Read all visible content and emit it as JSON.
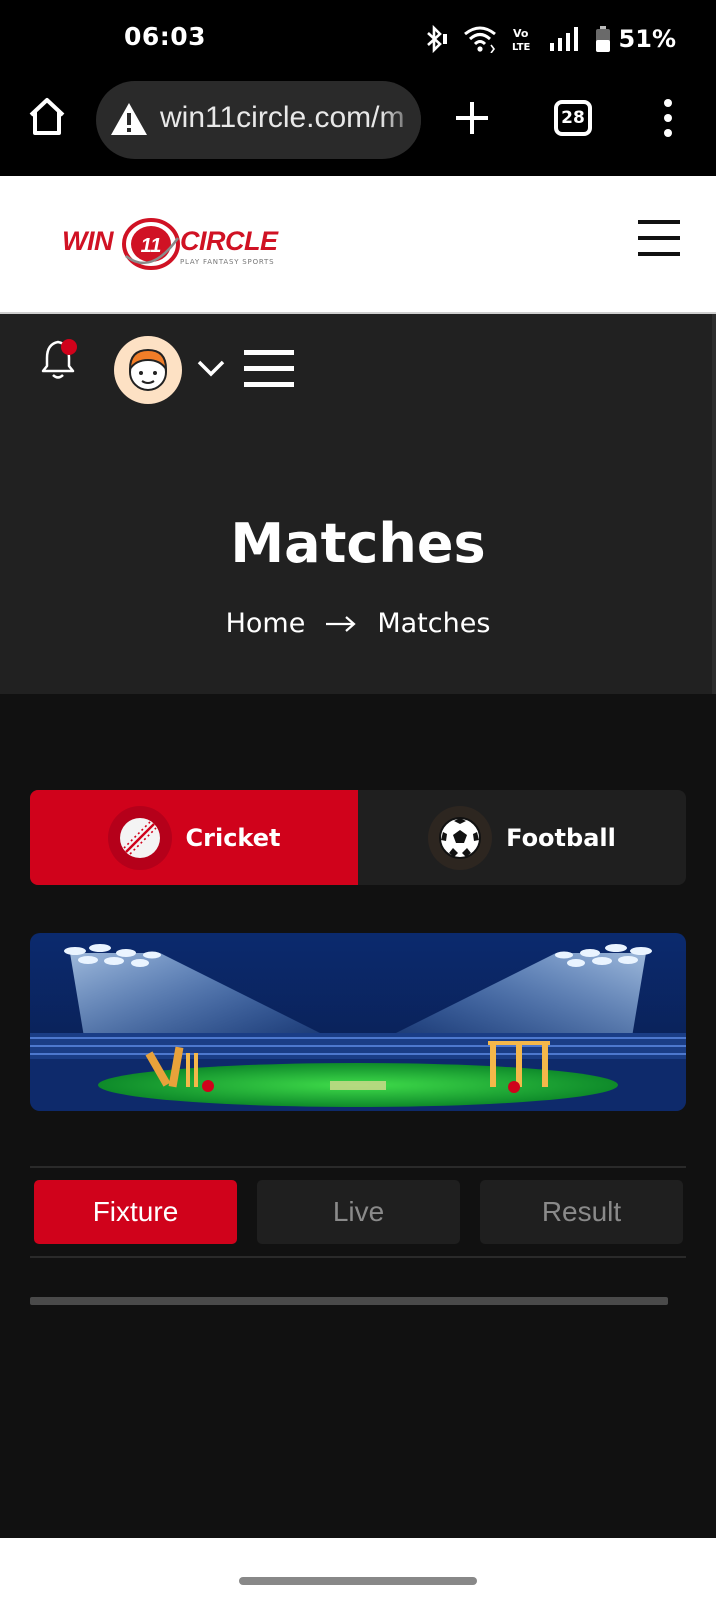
{
  "status_bar": {
    "time": "06:03",
    "battery": "51%",
    "icons": [
      "bluetooth-icon",
      "wifi-icon",
      "volte-icon",
      "signal-icon",
      "battery-icon"
    ]
  },
  "browser": {
    "url": "win11circle.com/m",
    "tab_count": "28",
    "icons": [
      "home-icon",
      "warning-icon",
      "plus-icon",
      "tabs-icon",
      "more-vert-icon"
    ]
  },
  "site_header": {
    "logo_left": "WIN",
    "logo_number": "11",
    "logo_right": "CIRCLE",
    "logo_tagline": "PLAY FANTASY SPORTS"
  },
  "hero": {
    "title": "Matches",
    "breadcrumb": {
      "home": "Home",
      "current": "Matches"
    }
  },
  "sport_tabs": [
    {
      "label": "Cricket",
      "icon": "cricket-ball-icon",
      "active": true
    },
    {
      "label": "Football",
      "icon": "football-icon",
      "active": false
    }
  ],
  "match_tabs": [
    {
      "label": "Fixture",
      "active": true
    },
    {
      "label": "Live",
      "active": false
    },
    {
      "label": "Result",
      "active": false
    }
  ],
  "colors": {
    "accent": "#d0021b",
    "hero_bg": "#212121",
    "page_bg": "#111111",
    "tab_inactive_bg": "#1f1f1f"
  }
}
